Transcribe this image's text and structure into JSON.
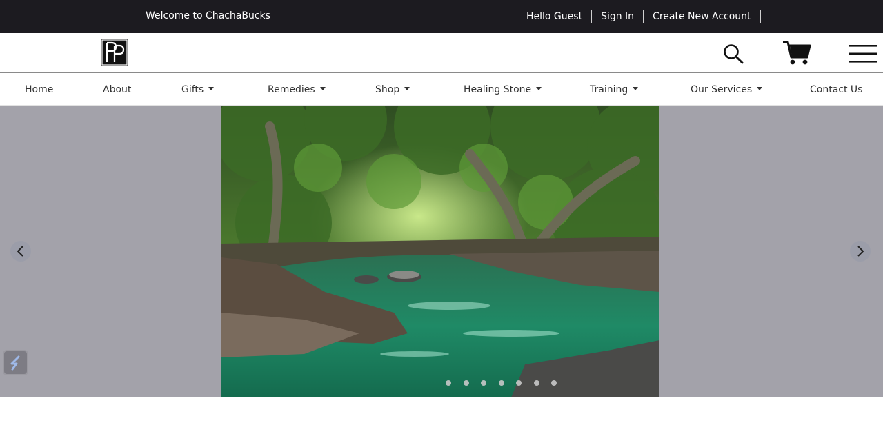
{
  "topbar": {
    "welcome": "Welcome to ChachaBucks",
    "greeting": "Hello Guest",
    "sign_in": "Sign In",
    "create_account": "Create New Account"
  },
  "header": {
    "logo": "logo",
    "icons": [
      "search-icon",
      "cart-icon",
      "hamburger-menu-icon"
    ]
  },
  "nav": {
    "items": [
      {
        "label": "Home",
        "dropdown": false
      },
      {
        "label": "About",
        "dropdown": false
      },
      {
        "label": "Gifts",
        "dropdown": true
      },
      {
        "label": "Remedies",
        "dropdown": true
      },
      {
        "label": "Shop",
        "dropdown": true
      },
      {
        "label": "Healing Stone",
        "dropdown": true
      },
      {
        "label": "Training",
        "dropdown": true
      },
      {
        "label": "Our Services",
        "dropdown": true
      },
      {
        "label": "Contact Us",
        "dropdown": false
      }
    ]
  },
  "slider": {
    "slide_count": 7,
    "active_slide": 1,
    "image": "forest river with green water and overhanging trees",
    "icons": [
      "chevron-left-icon",
      "chevron-right-icon"
    ]
  },
  "colors": {
    "topbar_bg": "#1c1b20",
    "hero_bg": "#a3a2aa",
    "water": "#1f8a66"
  }
}
